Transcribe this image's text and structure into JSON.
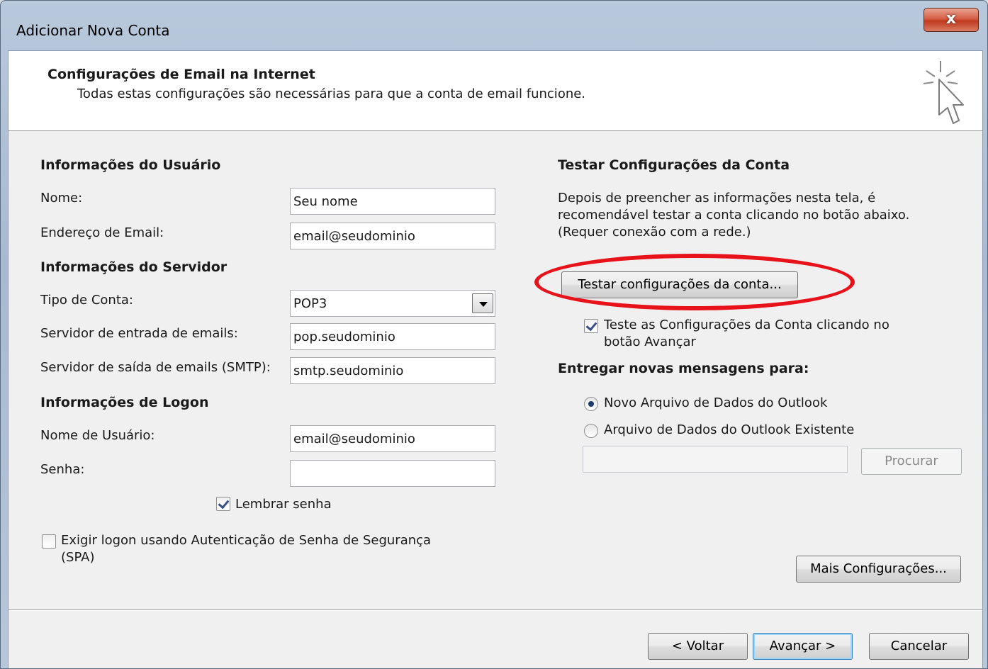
{
  "window": {
    "title": "Adicionar Nova Conta",
    "close_label": "x"
  },
  "header": {
    "title": "Configurações de Email na Internet",
    "subtitle": "Todas estas configurações são necessárias para que a conta de email funcione."
  },
  "user_info": {
    "heading": "Informações do Usuário",
    "name_label": "Nome:",
    "name_value": "Seu nome",
    "email_label": "Endereço de Email:",
    "email_value": "email@seudominio"
  },
  "server_info": {
    "heading": "Informações do Servidor",
    "account_type_label": "Tipo de Conta:",
    "account_type_value": "POP3",
    "incoming_label": "Servidor de entrada de emails:",
    "incoming_value": "pop.seudominio",
    "outgoing_label": "Servidor de saída de emails (SMTP):",
    "outgoing_value": "smtp.seudominio"
  },
  "logon_info": {
    "heading": "Informações de Logon",
    "username_label": "Nome de Usuário:",
    "username_value": "email@seudominio",
    "password_label": "Senha:",
    "password_value": "",
    "remember_label": "Lembrar senha",
    "remember_checked": true,
    "spa_label_line1": "Exigir logon usando Autenticação de Senha de Segurança",
    "spa_label_line2": "(SPA)",
    "spa_checked": false
  },
  "test_settings": {
    "heading": "Testar Configurações da Conta",
    "description_line1": "Depois de preencher as informações nesta tela, é",
    "description_line2": "recomendável testar a conta clicando no botão abaixo.",
    "description_line3": "(Requer conexão com a rede.)",
    "test_button_label": "Testar configurações da conta...",
    "auto_test_label_line1": "Teste as Configurações da Conta clicando no",
    "auto_test_label_line2": "botão Avançar",
    "auto_test_checked": true,
    "highlight_color": "#e8121a"
  },
  "deliver": {
    "heading": "Entregar novas mensagens para:",
    "option_new_label": "Novo Arquivo de Dados do Outlook",
    "option_existing_label": "Arquivo de Dados do Outlook Existente",
    "selected": "new",
    "existing_path_value": "",
    "browse_button_label": "Procurar"
  },
  "more_settings_label": "Mais Configurações...",
  "footer": {
    "back_label": "< Voltar",
    "next_label": "Avançar >",
    "cancel_label": "Cancelar"
  }
}
